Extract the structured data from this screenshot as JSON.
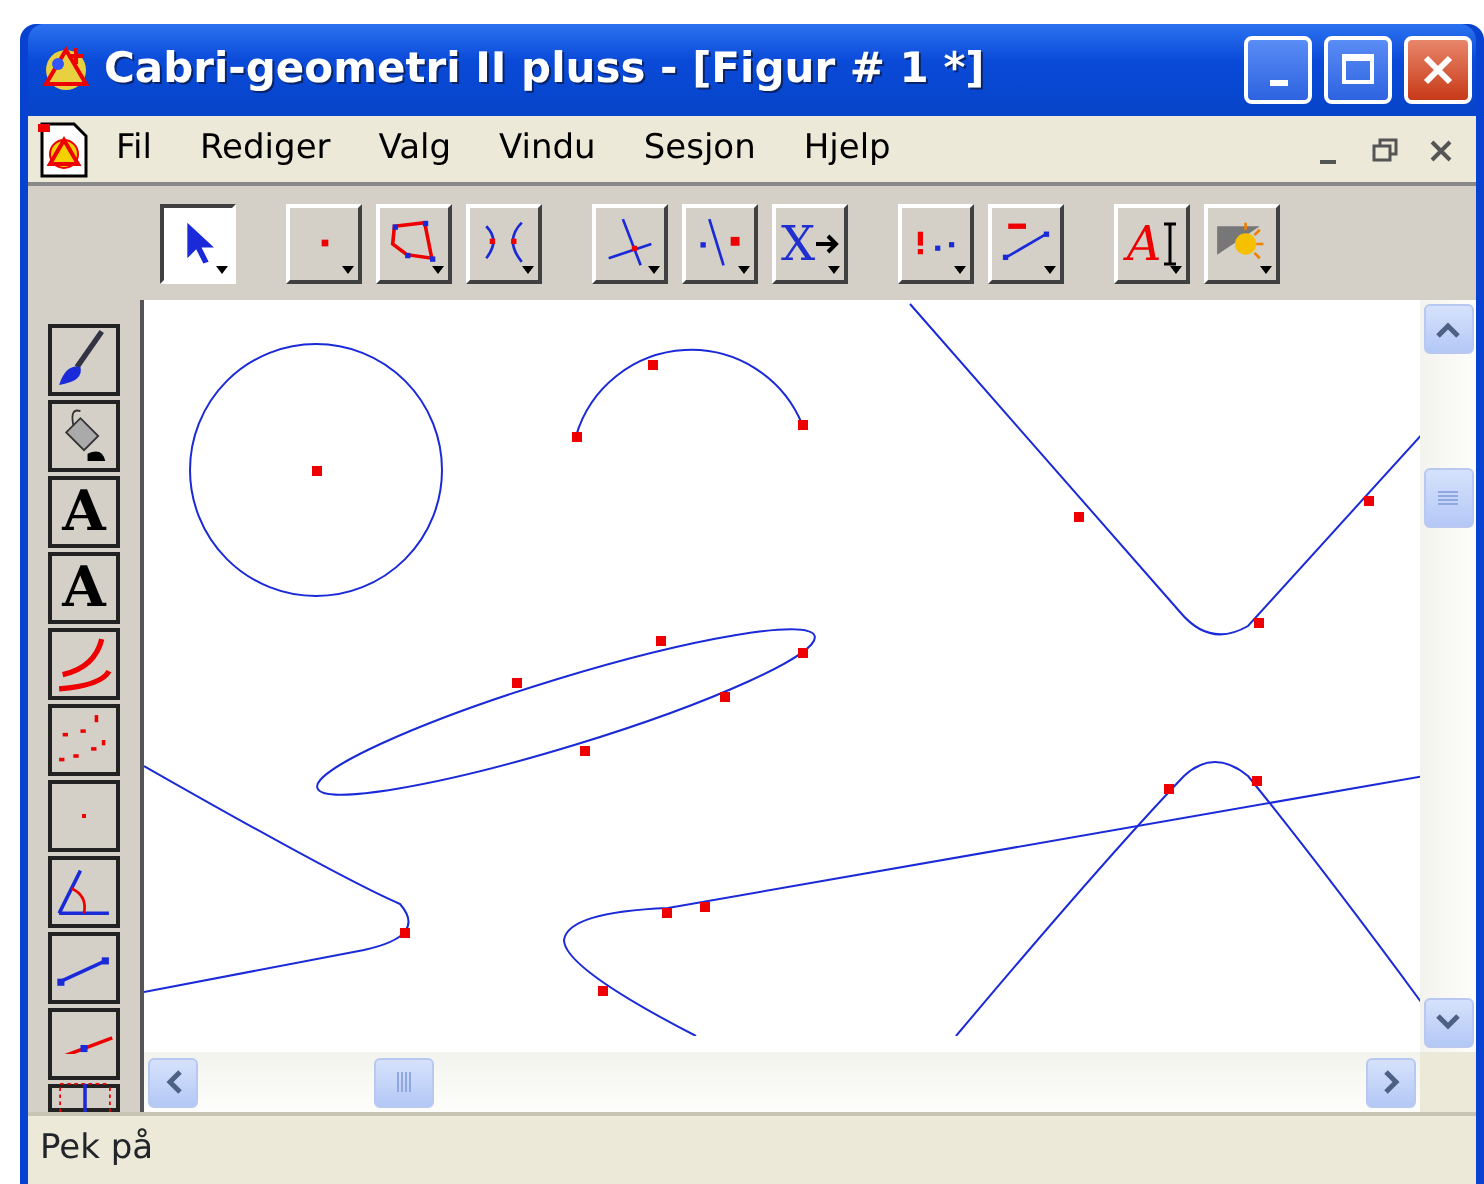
{
  "window": {
    "title": "Cabri-geometri II pluss - [Figur # 1 *]"
  },
  "menu": [
    "Fil",
    "Rediger",
    "Valg",
    "Vindu",
    "Sesjon",
    "Hjelp"
  ],
  "toolbar": [
    {
      "buttons": [
        {
          "kind": "pointer",
          "selected": true
        }
      ]
    },
    {
      "buttons": [
        {
          "kind": "point",
          "selected": false
        },
        {
          "kind": "polygon",
          "selected": false
        },
        {
          "kind": "curves",
          "selected": false
        }
      ]
    },
    {
      "buttons": [
        {
          "kind": "intersect",
          "selected": false
        },
        {
          "kind": "perpendicular",
          "selected": false
        },
        {
          "kind": "transform",
          "glyph": "X",
          "selected": false
        }
      ]
    },
    {
      "buttons": [
        {
          "kind": "check",
          "selected": false
        },
        {
          "kind": "measure",
          "selected": false
        }
      ]
    },
    {
      "buttons": [
        {
          "kind": "label",
          "glyph": "A",
          "selected": false
        },
        {
          "kind": "display",
          "selected": false
        }
      ]
    }
  ],
  "side_tools": [
    {
      "kind": "brush"
    },
    {
      "kind": "bucket"
    },
    {
      "kind": "letter",
      "glyph": "A"
    },
    {
      "kind": "letter-arrow",
      "glyph": "A"
    },
    {
      "kind": "arcs"
    },
    {
      "kind": "dots"
    },
    {
      "kind": "dot"
    },
    {
      "kind": "angle"
    },
    {
      "kind": "segment"
    },
    {
      "kind": "line-point"
    },
    {
      "kind": "partial"
    }
  ],
  "status_bar": "Pek på"
}
